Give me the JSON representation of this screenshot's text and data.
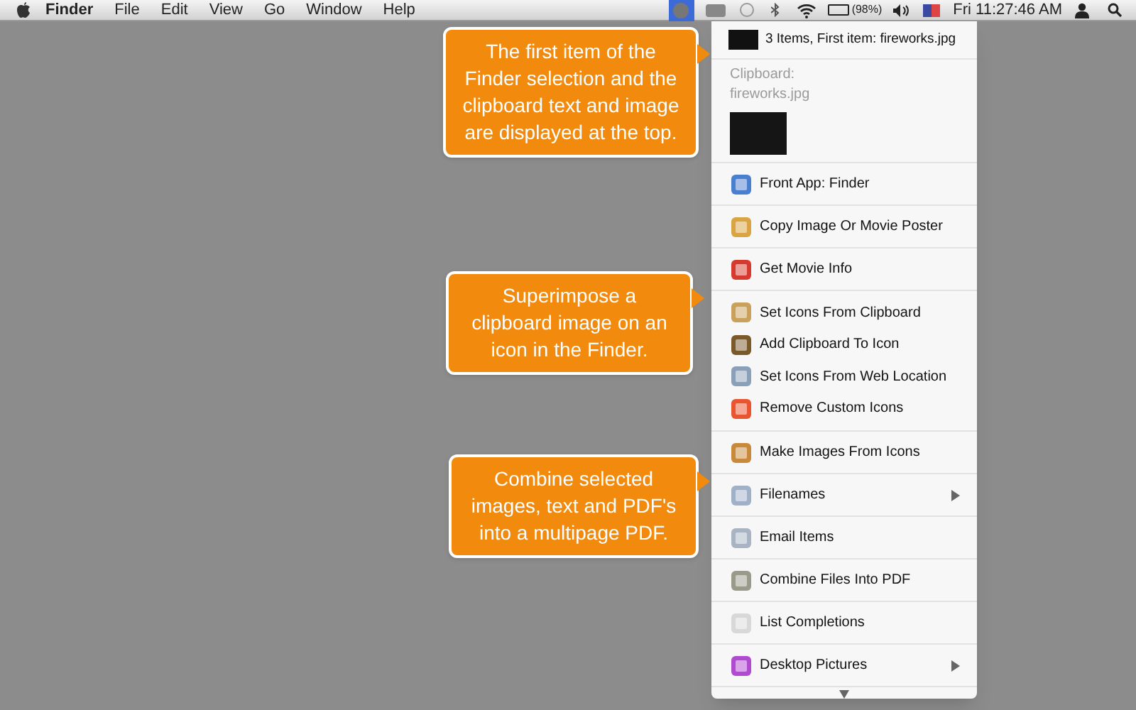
{
  "menu_bar": {
    "apps": [
      {
        "label": "Finder",
        "kind": "app"
      },
      {
        "label": "File",
        "kind": "menu"
      },
      {
        "label": "Edit",
        "kind": "menu"
      },
      {
        "label": "View",
        "kind": "menu"
      },
      {
        "label": "Go",
        "kind": "menu"
      },
      {
        "label": "Window",
        "kind": "menu"
      },
      {
        "label": "Help",
        "kind": "menu"
      }
    ],
    "status": {
      "extra_selected": true,
      "battery": "(98%)",
      "clock": "Fri 11:27:46 AM"
    }
  },
  "callouts": [
    {
      "text": "The first item of the Finder selection and the clipboard text and image are displayed at the top."
    },
    {
      "text": "Superimpose a clipboard image on an icon in the Finder."
    },
    {
      "text": "Combine selected images, text and PDF's into a multipage PDF."
    }
  ],
  "menu": {
    "header": "3 Items, First item: fireworks.jpg",
    "clipboard": [
      "Clipboard:",
      "fireworks.jpg"
    ],
    "sections": [
      {
        "items": [
          {
            "label": "Front App: Finder",
            "submenu": false
          }
        ]
      },
      {
        "items": [
          {
            "label": "Copy Image Or Movie Poster",
            "submenu": false
          }
        ]
      },
      {
        "items": [
          {
            "label": "Get Movie Info",
            "submenu": false
          }
        ]
      },
      {
        "items": [
          {
            "label": "Set Icons From Clipboard",
            "submenu": false
          },
          {
            "label": "Add Clipboard To Icon",
            "submenu": false
          },
          {
            "label": "Set Icons From Web Location",
            "submenu": false
          },
          {
            "label": "Remove Custom Icons",
            "submenu": false
          }
        ]
      },
      {
        "items": [
          {
            "label": "Make Images From Icons",
            "submenu": false
          }
        ]
      },
      {
        "items": [
          {
            "label": "Filenames",
            "submenu": true
          }
        ]
      },
      {
        "items": [
          {
            "label": "Email Items",
            "submenu": false
          }
        ]
      },
      {
        "items": [
          {
            "label": "Combine Files Into PDF",
            "submenu": false
          }
        ]
      },
      {
        "items": [
          {
            "label": "List Completions",
            "submenu": false
          }
        ]
      },
      {
        "items": [
          {
            "label": "Desktop Pictures",
            "submenu": true
          }
        ]
      }
    ],
    "more_below": true
  }
}
